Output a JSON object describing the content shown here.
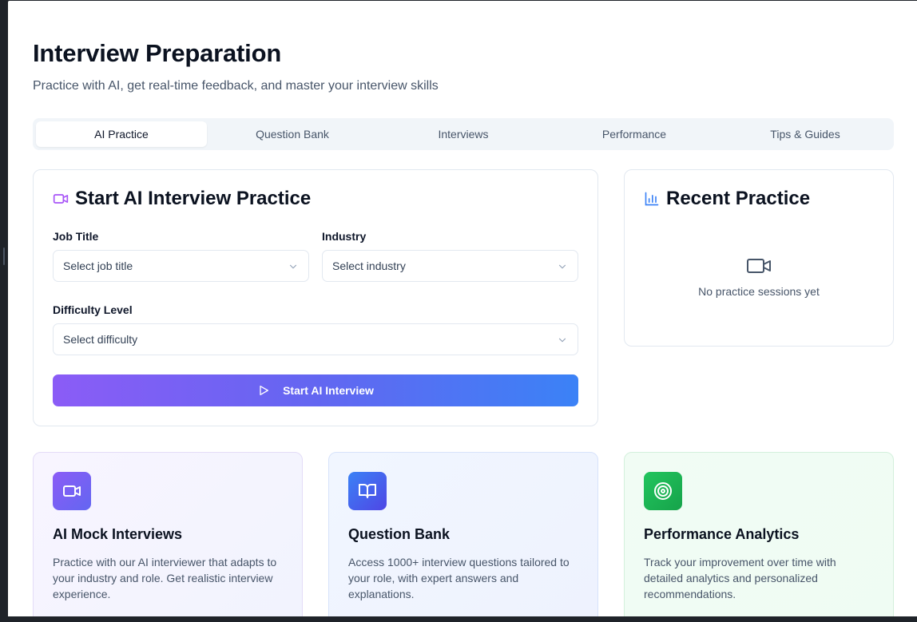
{
  "header": {
    "title": "Interview Preparation",
    "subtitle": "Practice with AI, get real-time feedback, and master your interview skills"
  },
  "tabs": [
    {
      "label": "AI Practice",
      "active": true
    },
    {
      "label": "Question Bank",
      "active": false
    },
    {
      "label": "Interviews",
      "active": false
    },
    {
      "label": "Performance",
      "active": false
    },
    {
      "label": "Tips & Guides",
      "active": false
    }
  ],
  "practice": {
    "title": "Start AI Interview Practice",
    "icon": "video-icon",
    "job_title": {
      "label": "Job Title",
      "placeholder": "Select job title"
    },
    "industry": {
      "label": "Industry",
      "placeholder": "Select industry"
    },
    "difficulty": {
      "label": "Difficulty Level",
      "placeholder": "Select difficulty"
    },
    "start_button": "Start AI Interview"
  },
  "recent": {
    "title": "Recent Practice",
    "icon": "bar-chart-icon",
    "empty_text": "No practice sessions yet"
  },
  "features": [
    {
      "title": "AI Mock Interviews",
      "description": "Practice with our AI interviewer that adapts to your industry and role. Get realistic interview experience.",
      "icon": "video-icon"
    },
    {
      "title": "Question Bank",
      "description": "Access 1000+ interview questions tailored to your role, with expert answers and explanations.",
      "icon": "book-icon"
    },
    {
      "title": "Performance Analytics",
      "description": "Track your improvement over time with detailed analytics and personalized recommendations.",
      "icon": "target-icon"
    }
  ],
  "colors": {
    "accent_purple": "#8b5cf6",
    "accent_blue": "#3b82f6",
    "accent_green": "#22c55e"
  }
}
